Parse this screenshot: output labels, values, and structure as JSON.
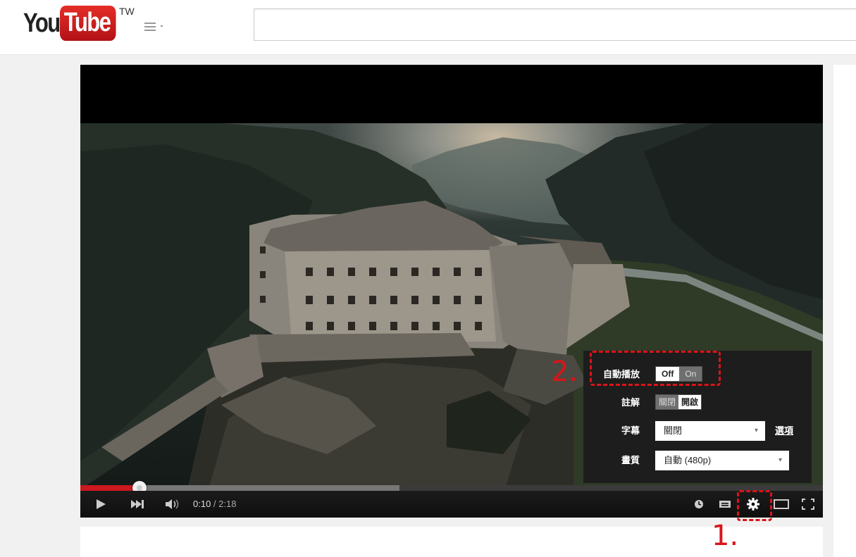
{
  "header": {
    "logo_you": "You",
    "logo_tube": "Tube",
    "logo_region": "TW",
    "search_placeholder": ""
  },
  "player": {
    "time_current": "0:10",
    "time_separator": " / ",
    "time_duration": "2:18",
    "played_fraction": 0.08,
    "loaded_fraction": 0.43
  },
  "settings": {
    "autoplay": {
      "label": "自動播放",
      "off": "Off",
      "on": "On",
      "selected": "off"
    },
    "annotations": {
      "label": "註解",
      "off": "關閉",
      "on": "開啟",
      "selected": "on"
    },
    "subtitles": {
      "label": "字幕",
      "value": "關閉",
      "options_link": "選項"
    },
    "quality": {
      "label": "畫質",
      "value": "自動 (480p)"
    }
  },
  "annotations": {
    "step1": "1.",
    "step2": "2.",
    "color": "#d9141a"
  },
  "colors": {
    "youtube_red": "#e52d27",
    "progress_red": "#cc181e"
  }
}
